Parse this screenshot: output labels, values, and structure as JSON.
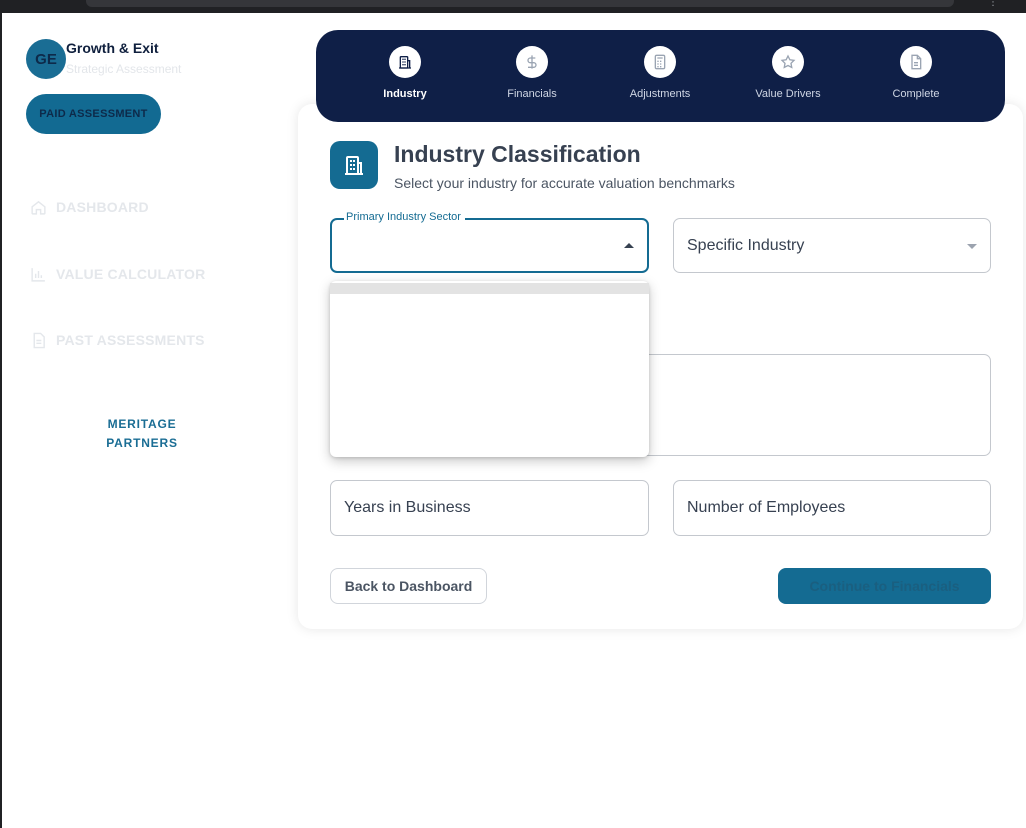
{
  "brand": {
    "initials": "GE",
    "name": "Growth & Exit",
    "subtitle": "Strategic Assessment",
    "badge": "PAID ASSESSMENT"
  },
  "nav": {
    "items": [
      {
        "label": "DASHBOARD",
        "icon": "home-icon"
      },
      {
        "label": "VALUE CALCULATOR",
        "icon": "bar-chart-icon"
      },
      {
        "label": "PAST ASSESSMENTS",
        "icon": "document-icon"
      }
    ],
    "partner_line1": "MERITAGE",
    "partner_line2": "PARTNERS"
  },
  "stepper": {
    "steps": [
      {
        "label": "Industry",
        "icon": "building-icon",
        "active": true
      },
      {
        "label": "Financials",
        "icon": "dollar-icon",
        "active": false
      },
      {
        "label": "Adjustments",
        "icon": "calculator-icon",
        "active": false
      },
      {
        "label": "Value Drivers",
        "icon": "star-icon",
        "active": false
      },
      {
        "label": "Complete",
        "icon": "file-icon",
        "active": false
      }
    ]
  },
  "form": {
    "title": "Industry Classification",
    "subtitle": "Select your industry for accurate valuation benchmarks",
    "primary_sector_label": "Primary Industry Sector",
    "primary_sector_value": "",
    "specific_industry_placeholder": "Specific Industry",
    "years_placeholder": "Years in Business",
    "employees_placeholder": "Number of Employees",
    "back_label": "Back to Dashboard",
    "continue_label": "Continue to Financials"
  },
  "colors": {
    "accent": "#146b92",
    "stepper_bg": "#0f1f47"
  }
}
